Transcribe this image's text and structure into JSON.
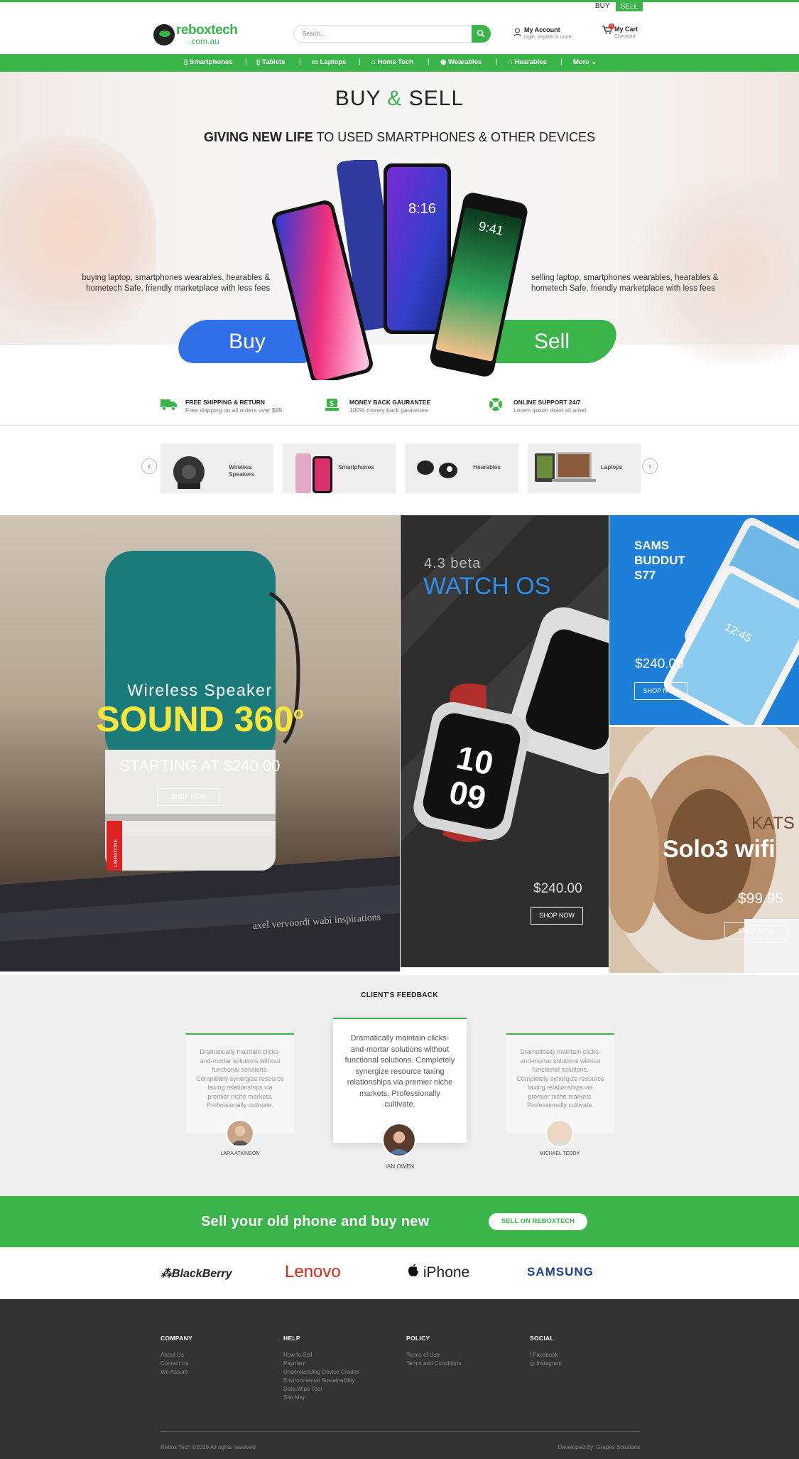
{
  "topbar": {
    "buy": "BUY",
    "sell": "SELL"
  },
  "header": {
    "logo_main": "reboxtech",
    "logo_sub": ".com.au",
    "search_placeholder": "Search...",
    "account_title": "My Account",
    "account_sub": "login, register & more",
    "cart_title": "My Cart",
    "cart_sub": "Checkout",
    "cart_count": "0"
  },
  "nav": [
    {
      "label": "Smartphones",
      "icon": "smartphone-icon"
    },
    {
      "label": "Tablets",
      "icon": "tablet-icon"
    },
    {
      "label": "Laptops",
      "icon": "laptop-icon"
    },
    {
      "label": "Home Tech",
      "icon": "home-icon"
    },
    {
      "label": "Wearables",
      "icon": "watch-icon"
    },
    {
      "label": "Hearables",
      "icon": "headphones-icon"
    },
    {
      "label": "More",
      "icon": "chevron-down-icon"
    }
  ],
  "hero": {
    "title_a": "BUY",
    "title_amp": "&",
    "title_b": "SELL",
    "subtitle_bold": "GIVING NEW LIFE",
    "subtitle_rest": " TO USED SMARTPHONES & OTHER DEVICES",
    "left_text": "buying laptop, smartphones wearables, hearables & hometech Safe, friendly marketplace with less fees",
    "right_text": "selling laptop, smartphones wearables, hearables & hometech Safe, friendly marketplace with less fees",
    "buy_label": "Buy",
    "sell_label": "Sell",
    "phone_time": "8:16",
    "phone_time2": "9:41"
  },
  "features": [
    {
      "title": "FREE SHIPPING & RETURN",
      "sub": "Free shipping on all orders over $99",
      "icon": "truck-icon"
    },
    {
      "title": "MONEY BACK GAURANTEE",
      "sub": "100% money back gaurantee",
      "icon": "money-icon"
    },
    {
      "title": "ONLINE SUPPORT 24/7",
      "sub": "Lorem ipsum dolor sit amet",
      "icon": "lifebuoy-icon"
    }
  ],
  "categories": [
    {
      "label_1": "Wireless",
      "label_2": "Speakers",
      "icon": "speaker-icon"
    },
    {
      "label_1": "Smartphones",
      "label_2": "",
      "icon": "smartphones-icon"
    },
    {
      "label_1": "Hearables",
      "label_2": "",
      "icon": "earbuds-icon"
    },
    {
      "label_1": "Laptops",
      "label_2": "",
      "icon": "laptop-icon"
    }
  ],
  "banners": {
    "speaker": {
      "kicker": "Wireless Speaker",
      "headline": "SOUND 360",
      "degree": "o",
      "price": "STARTING AT $240.00",
      "button": "SHOP NOW",
      "book_text": "axel vervoordt wabi inspirations",
      "brand": "LIBRATONE"
    },
    "watch": {
      "kicker": "4.3 beta",
      "headline": "WATCH OS",
      "price": "$240.00",
      "button": "SHOP NOW",
      "face_1": "10",
      "face_2": "09"
    },
    "tablet": {
      "headline_1": "SAMS",
      "headline_2": "BUDDUT",
      "headline_3": "S77",
      "price": "$240.00",
      "button": "SHOP NOW",
      "screen_time": "12:45"
    },
    "headphones": {
      "kicker": "KATS",
      "headline": "Solo3 wifi",
      "price": "$99.95",
      "button": "SHOP NOW"
    }
  },
  "feedback": {
    "title": "CLIENT'S FEEDBACK",
    "quote": "Dramatically maintain clicks-and-mortar solutions without functional solutions. Completely synergize resource taxing relationships via premier niche markets. Professionally cultivate.",
    "clients": [
      "LARA ATKINSON",
      "IAN OWEN",
      "MICHAEL TEDDY"
    ]
  },
  "sellbar": {
    "text": "Sell your old phone and buy new",
    "button": "SELL ON REBOXTECH"
  },
  "brands": [
    "BlackBerry",
    "Lenovo",
    "iPhone",
    "SAMSUNG"
  ],
  "footer": {
    "company": {
      "title": "COMPANY",
      "links": [
        "About Us",
        "Contact Us",
        "We Assure"
      ]
    },
    "help": {
      "title": "HELP",
      "links": [
        "How to Sell",
        "Payment",
        "Understanding Device Grades",
        "Environmental Sustainability",
        "Data Wipe Tool",
        "Site Map"
      ]
    },
    "policy": {
      "title": "POLICY",
      "links": [
        "Terms of Use",
        "Terms and Conditions"
      ]
    },
    "social": {
      "title": "SOCIAL",
      "links": [
        "Facebook",
        "Instagram"
      ]
    },
    "copyright": "Rebox Tech ©2019 All rights reserved",
    "developer": "Developed By: Grapes Solutions"
  },
  "colors": {
    "brand_green": "#3bb54a",
    "buy_blue": "#2f6fe8",
    "footer_bg": "#333333",
    "tablet_blue": "#1e7fd8"
  }
}
